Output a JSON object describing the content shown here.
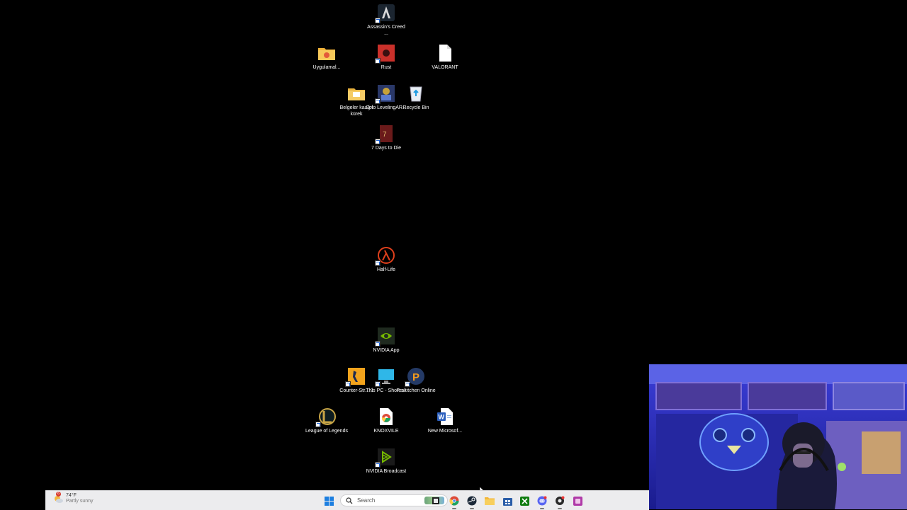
{
  "desktop": {
    "icons": [
      {
        "label": "Assassin's Creed ...",
        "icon": "assassins-creed-icon"
      },
      {
        "label": "Uygulamal...",
        "icon": "folder-icon"
      },
      {
        "label": "Rust",
        "icon": "rust-icon"
      },
      {
        "label": "VALORANT",
        "icon": "blank-file-icon"
      },
      {
        "label": "Belgeler kaağıt kürek",
        "icon": "folder-icon"
      },
      {
        "label": "Solo LevelingAR...",
        "icon": "solo-leveling-icon"
      },
      {
        "label": "Recycle Bin",
        "icon": "recycle-bin-icon"
      },
      {
        "label": "7 Days to Die",
        "icon": "seven-days-to-die-icon"
      },
      {
        "label": "Half-Life",
        "icon": "half-life-icon"
      },
      {
        "label": "NVIDIA App",
        "icon": "nvidia-icon"
      },
      {
        "label": "Counter-Str... 2",
        "icon": "counter-strike-icon"
      },
      {
        "label": "This PC - Shortcut",
        "icon": "this-pc-icon"
      },
      {
        "label": "Prokitchen Online",
        "icon": "prokitchen-icon"
      },
      {
        "label": "League of Legends",
        "icon": "league-of-legends-icon"
      },
      {
        "label": "KNOXVILE",
        "icon": "chrome-icon"
      },
      {
        "label": "New Microsof...",
        "icon": "word-document-icon"
      },
      {
        "label": "NVIDIA Broadcast",
        "icon": "nvidia-broadcast-icon"
      }
    ]
  },
  "taskbar": {
    "weather": {
      "temperature": "74°F",
      "condition": "Partly sunny",
      "badge": "6"
    },
    "search": {
      "placeholder": "Search"
    },
    "apps": [
      "start-icon",
      "task-view-icon",
      "chrome-icon",
      "steam-icon",
      "file-explorer-icon",
      "store-icon",
      "xbox-icon",
      "discord-icon",
      "app-icon",
      "app-icon"
    ]
  }
}
